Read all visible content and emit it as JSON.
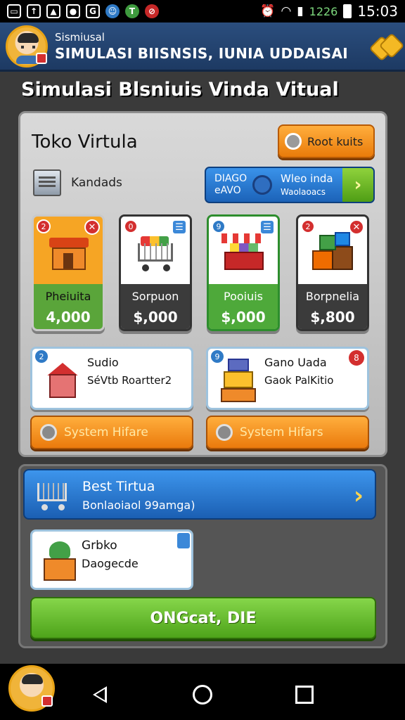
{
  "status_bar": {
    "battery_percent": "1226",
    "time": "15:03"
  },
  "header": {
    "subtitle": "Sismiusal",
    "title": "SIMULASI BIISNSIS, IUNIA UDDAISAI"
  },
  "page_title": "Simulasi Blsniuis Vinda Vitual",
  "store": {
    "title": "Toko Virtula",
    "reset_button": "Root kuits",
    "machine_label": "Kandads",
    "promo": {
      "left_line1": "DIAGO",
      "left_line2": "eAVO",
      "right_line1": "Wleo inda",
      "right_line2": "Waolaoacs",
      "arrow": "›"
    }
  },
  "products": [
    {
      "number": "2",
      "corner": "✕",
      "name": "Pheiuita",
      "price": "4,000"
    },
    {
      "number": "0",
      "corner": "☰",
      "name": "Sorpuon",
      "price": "$,000"
    },
    {
      "number": "9",
      "corner": "☰",
      "name": "Pooiuis",
      "price": "$,000"
    },
    {
      "number": "2",
      "corner": "✕",
      "name": "Borpnelia",
      "price": "$,800"
    }
  ],
  "info_cards": [
    {
      "number": "2",
      "line1": "Sudio",
      "line2": "SéVtb Roartter2"
    },
    {
      "number": "9",
      "corner": "8",
      "line1": "Gano Uada",
      "line2": "Gaok PalKitio"
    }
  ],
  "system_buttons": [
    "System Hifare",
    "System Hifars"
  ],
  "best": {
    "title": "Best Tirtua",
    "subtitle": "Bonlaoiaol 99amga)",
    "chevron": "›"
  },
  "gift": {
    "line1": "Grbko",
    "line2": "Daogecde"
  },
  "create_button": "ONGcat, DIE"
}
